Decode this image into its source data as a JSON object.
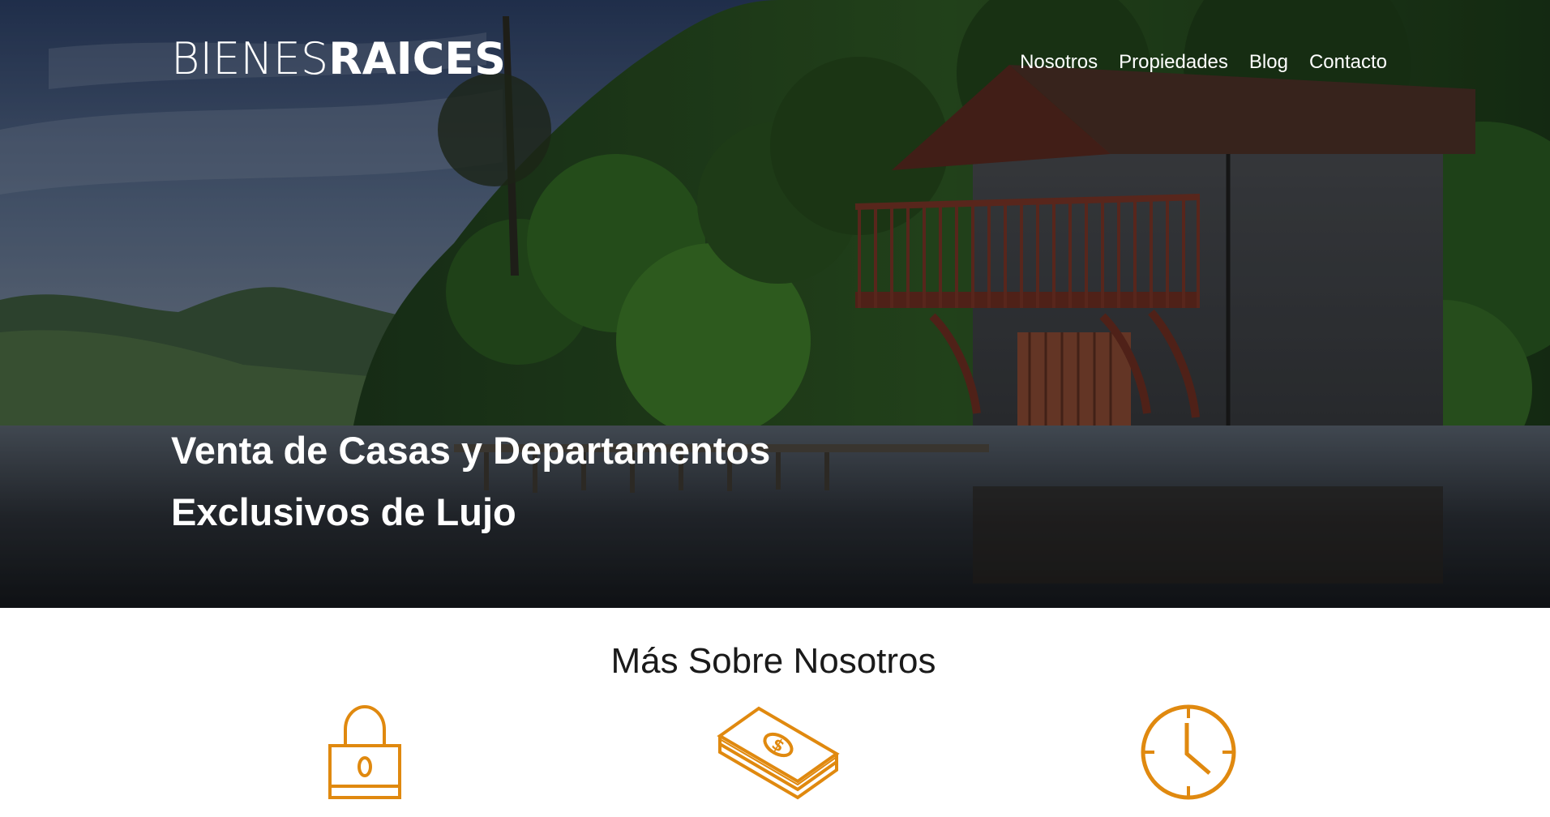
{
  "brand": {
    "logo_light": "BIENES",
    "logo_bold": "RAICES"
  },
  "nav": {
    "items": [
      {
        "label": "Nosotros"
      },
      {
        "label": "Propiedades"
      },
      {
        "label": "Blog"
      },
      {
        "label": "Contacto"
      }
    ]
  },
  "hero": {
    "title_line1": "Venta de Casas y Departamentos",
    "title_line2": "Exclusivos de Lujo"
  },
  "about": {
    "title": "Más Sobre Nosotros",
    "icons": [
      "lock-icon",
      "money-icon",
      "clock-icon"
    ]
  },
  "colors": {
    "accent": "#e0890f",
    "text_dark": "#1a1a1a",
    "white": "#ffffff"
  }
}
